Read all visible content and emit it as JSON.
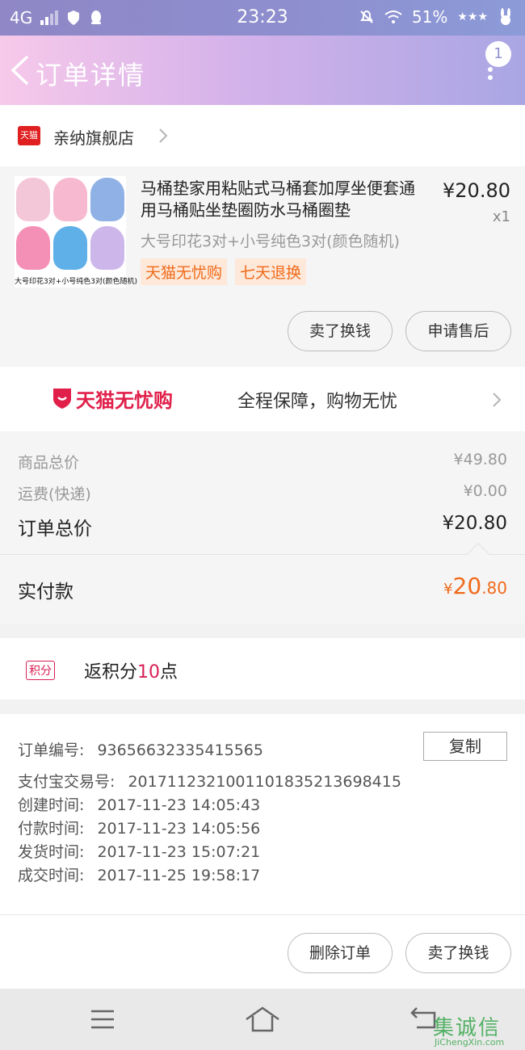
{
  "status_bar": {
    "network": "4G",
    "time": "23:23",
    "battery": "51%"
  },
  "header": {
    "title": "订单详情",
    "notification_count": "1"
  },
  "shop": {
    "logo_text": "天猫",
    "name": "亲纳旗舰店"
  },
  "product": {
    "title": "马桶垫家用粘贴式马桶套加厚坐便套通用马桶贴坐垫圈防水马桶圈垫",
    "price": "¥20.80",
    "quantity": "x1",
    "spec": "大号印花3对+小号纯色3对(颜色随机)",
    "image_caption": "大号印花3对+小号纯色3对(颜色随机)",
    "tags": [
      "天猫无忧购",
      "七天退换"
    ],
    "buttons": {
      "sell": "卖了换钱",
      "after_sale": "申请售后"
    }
  },
  "promo": {
    "brand": "天猫无忧购",
    "slogan": "全程保障，购物无忧"
  },
  "summary": {
    "goods_total_label": "商品总价",
    "goods_total_value": "¥49.80",
    "shipping_label": "运费(快递)",
    "shipping_value": "¥0.00",
    "order_total_label": "订单总价",
    "order_total_value": "¥20.80"
  },
  "payment": {
    "label": "实付款",
    "currency": "¥",
    "integer": "20",
    "decimal": ".80"
  },
  "points": {
    "tag": "积分",
    "prefix": "返积分",
    "value": "10",
    "suffix": "点"
  },
  "order_info": {
    "order_no_label": "订单编号:",
    "order_no": "93656632335415565",
    "copy_label": "复制",
    "alipay_label": "支付宝交易号:",
    "alipay_no": "2017112321001101835213698415",
    "created_label": "创建时间:",
    "created": "2017-11-23 14:05:43",
    "paid_label": "付款时间:",
    "paid": "2017-11-23 14:05:56",
    "shipped_label": "发货时间:",
    "shipped": "2017-11-23 15:07:21",
    "completed_label": "成交时间:",
    "completed": "2017-11-25 19:58:17"
  },
  "actions": {
    "delete": "删除订单",
    "sell": "卖了换钱"
  },
  "watermark": {
    "mark": "集诚信",
    "url": "JiChengXin.com"
  },
  "colors": {
    "header_gradient_start": "#f7c9ea",
    "header_gradient_end": "#a9a6e4",
    "accent_orange": "#f06a1a",
    "tmall_red": "#e0204a",
    "points_red": "#d92055"
  }
}
